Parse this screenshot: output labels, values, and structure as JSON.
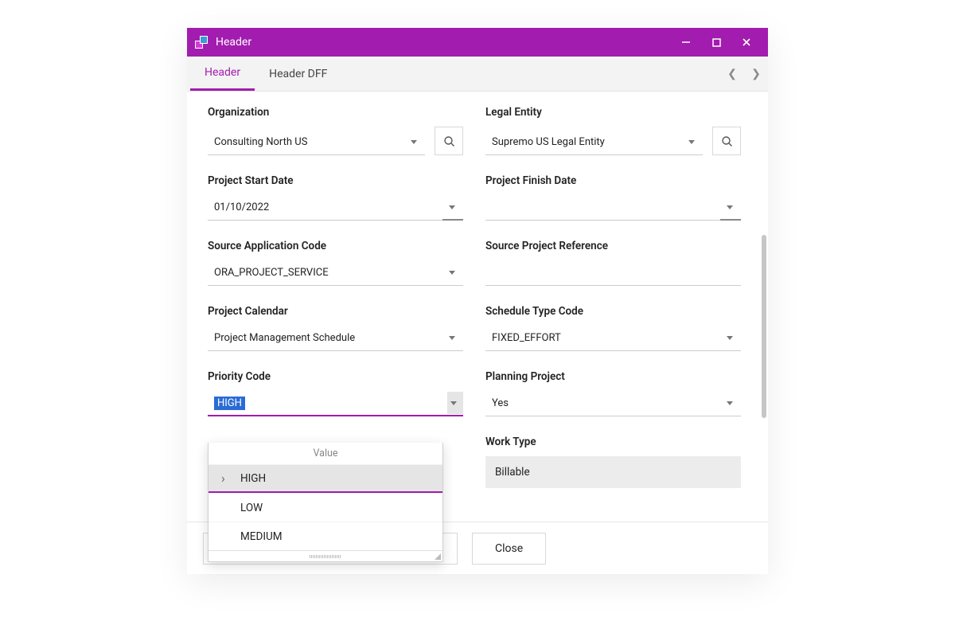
{
  "window": {
    "title": "Header"
  },
  "tabs": {
    "items": [
      {
        "label": "Header"
      },
      {
        "label": "Header DFF"
      }
    ]
  },
  "fields": {
    "organization": {
      "label": "Organization",
      "value": "Consulting North US"
    },
    "legal_entity": {
      "label": "Legal Entity",
      "value": "Supremo US Legal Entity"
    },
    "project_start_date": {
      "label": "Project Start Date",
      "value": "01/10/2022"
    },
    "project_finish_date": {
      "label": "Project Finish Date",
      "value": ""
    },
    "source_app_code": {
      "label": "Source Application Code",
      "value": "ORA_PROJECT_SERVICE"
    },
    "source_project_ref": {
      "label": "Source Project Reference",
      "value": ""
    },
    "project_calendar": {
      "label": "Project Calendar",
      "value": "Project Management Schedule"
    },
    "schedule_type_code": {
      "label": "Schedule Type Code",
      "value": "FIXED_EFFORT"
    },
    "priority_code": {
      "label": "Priority Code",
      "value": "HIGH",
      "dropdown_header": "Value",
      "options": [
        "HIGH",
        "LOW",
        "MEDIUM"
      ]
    },
    "planning_project": {
      "label": "Planning Project",
      "value": "Yes"
    },
    "work_type": {
      "label": "Work Type",
      "value": "Billable"
    }
  },
  "footer": {
    "close": "Close"
  }
}
